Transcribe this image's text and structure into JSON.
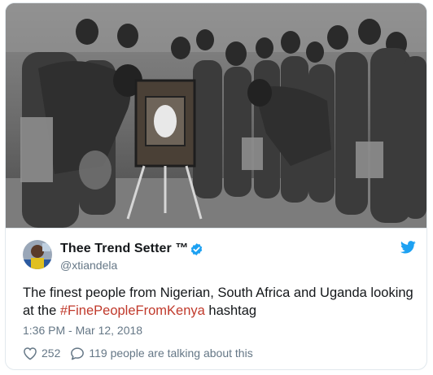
{
  "media": {
    "icon": "historical-group-photo",
    "alt": "Black and white photograph of a group of people gathered around a box"
  },
  "author": {
    "display_name": "Thee Trend Setter ™",
    "handle": "@xtiandela",
    "verified": true,
    "avatar_icon": "avatar-image"
  },
  "tweet": {
    "text_before": "The finest people from Nigerian, South Africa and Uganda looking at the ",
    "hashtag": "#FinePeopleFromKenya",
    "text_after": " hashtag",
    "timestamp": "1:36 PM - Mar 12, 2018"
  },
  "engagement": {
    "likes": "252",
    "talking": "119 people are talking about this"
  },
  "colors": {
    "hashtag": "#c0392b",
    "verified": "#1da1f2",
    "twitter_bird": "#1da1f2",
    "muted_text": "#657786",
    "border": "#e1e8ed"
  }
}
